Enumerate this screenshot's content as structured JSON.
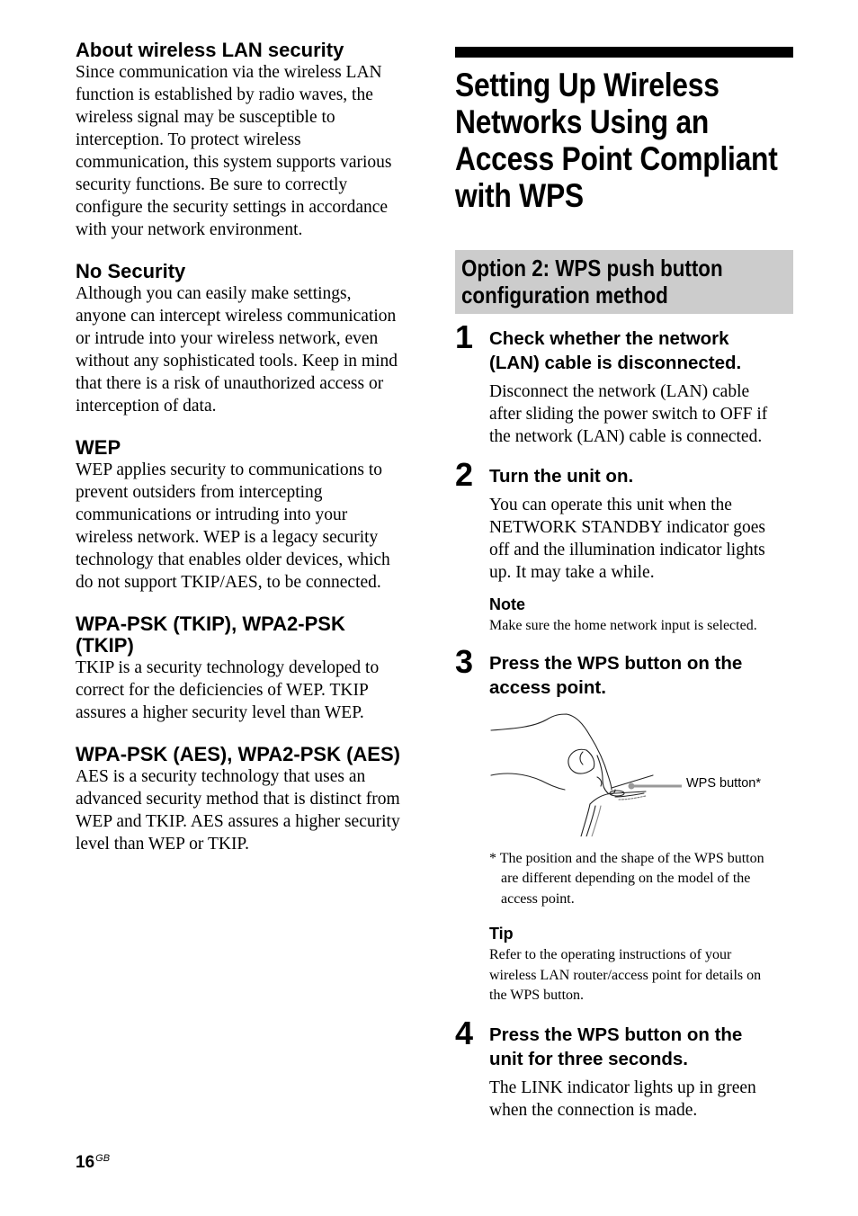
{
  "left_column": {
    "sections": [
      {
        "heading": "About wireless LAN security",
        "lines": [
          "Since communication via the wireless LAN",
          "function is established by radio waves, the",
          "wireless signal may be susceptible to",
          "interception. To protect wireless",
          "communication, this system supports various",
          "security functions. Be sure to correctly",
          "configure the security settings in accordance",
          "with your network environment."
        ]
      },
      {
        "heading": "No Security",
        "lines": [
          "Although you can easily make settings,",
          "anyone can intercept wireless communication",
          "or intrude into your wireless network, even",
          "without any sophisticated tools. Keep in mind",
          "that there is a risk of unauthorized access or",
          "interception of data."
        ]
      },
      {
        "heading": "WEP",
        "lines": [
          "WEP applies security to communications to",
          "prevent outsiders from intercepting",
          "communications or intruding into your",
          "wireless network. WEP is a legacy security",
          "technology that enables older devices, which",
          "do not support TKIP/AES, to be connected."
        ]
      },
      {
        "heading_lines": [
          "WPA-PSK (TKIP), WPA2-PSK",
          "(TKIP)"
        ],
        "lines": [
          "TKIP is a security technology developed to",
          "correct for the deficiencies of WEP. TKIP",
          "assures a higher security level than WEP."
        ]
      },
      {
        "heading": "WPA-PSK (AES), WPA2-PSK (AES)",
        "lines": [
          "AES is a security technology that uses an",
          "advanced security method that is distinct from",
          "WEP and TKIP. AES assures a higher security",
          "level than WEP or TKIP."
        ]
      }
    ]
  },
  "right_column": {
    "title_lines": [
      "Setting Up Wireless",
      "Networks Using an",
      "Access Point Compliant",
      "with WPS"
    ],
    "option_lines": [
      "Option 2: WPS push button",
      "configuration method"
    ],
    "steps": [
      {
        "number": "1",
        "heading_lines": [
          "Check whether the network",
          "(LAN) cable is disconnected."
        ],
        "body_lines": [
          "Disconnect the network (LAN) cable",
          "after sliding the power switch to OFF if",
          "the network (LAN) cable is connected."
        ]
      },
      {
        "number": "2",
        "heading_lines": [
          "Turn the unit on."
        ],
        "body_lines": [
          "You can operate this unit when the",
          "NETWORK STANDBY indicator goes",
          "off and the illumination indicator lights",
          "up. It may take a while."
        ],
        "note": {
          "heading": "Note",
          "text": "Make sure the home network input is selected."
        }
      },
      {
        "number": "3",
        "heading_lines": [
          "Press the WPS button on the",
          "access point."
        ],
        "illustration": {
          "icon": "hand-pressing-button-illustration",
          "label": "WPS button*"
        },
        "footnote_lines": [
          "* The position and the shape of the WPS button",
          "are different depending on the model of the",
          "access point."
        ],
        "tip": {
          "heading": "Tip",
          "lines": [
            "Refer to the operating instructions of your",
            "wireless LAN router/access point for details on",
            "the WPS button."
          ]
        }
      },
      {
        "number": "4",
        "heading_lines": [
          "Press the WPS button on the",
          "unit for three seconds."
        ],
        "body_lines": [
          "The LINK indicator lights up in green",
          "when the connection is made."
        ]
      }
    ]
  },
  "footer": {
    "page_number": "16",
    "region_code": "GB"
  }
}
